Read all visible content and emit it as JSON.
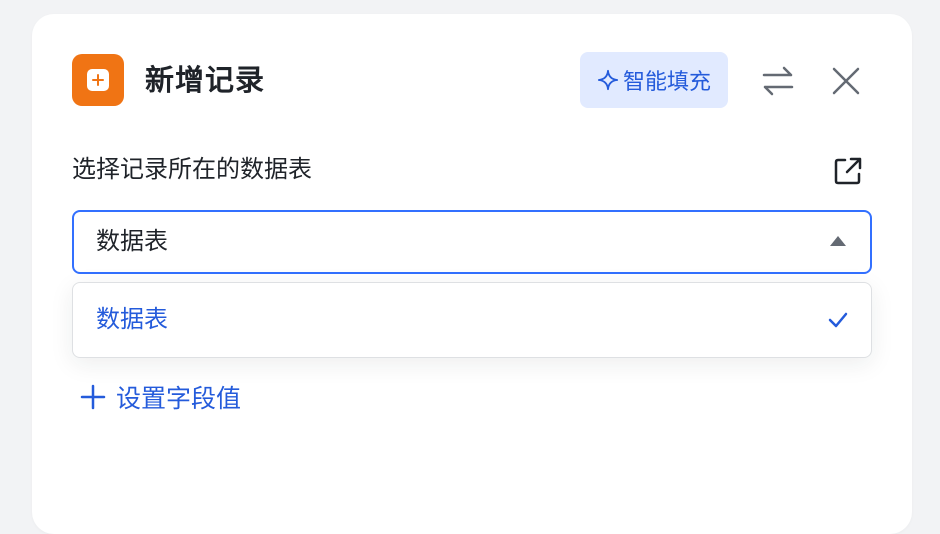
{
  "header": {
    "title": "新增记录",
    "smart_fill_label": "智能填充"
  },
  "table_select": {
    "label": "选择记录所在的数据表",
    "value": "数据表",
    "options": [
      {
        "label": "数据表",
        "selected": true
      }
    ]
  },
  "add_field": {
    "label": "设置字段值"
  },
  "icons": {
    "app": "add-record-icon",
    "smart_fill": "sparkle-icon",
    "switch": "swap-arrows-icon",
    "close": "close-icon",
    "external": "open-external-icon",
    "caret": "caret-up-icon",
    "check": "check-icon",
    "add": "plus-icon"
  },
  "colors": {
    "accent": "#3370ff",
    "accent_text": "#245bdb",
    "app_icon": "#f07414",
    "smart_fill_bg": "#e1eaff"
  }
}
